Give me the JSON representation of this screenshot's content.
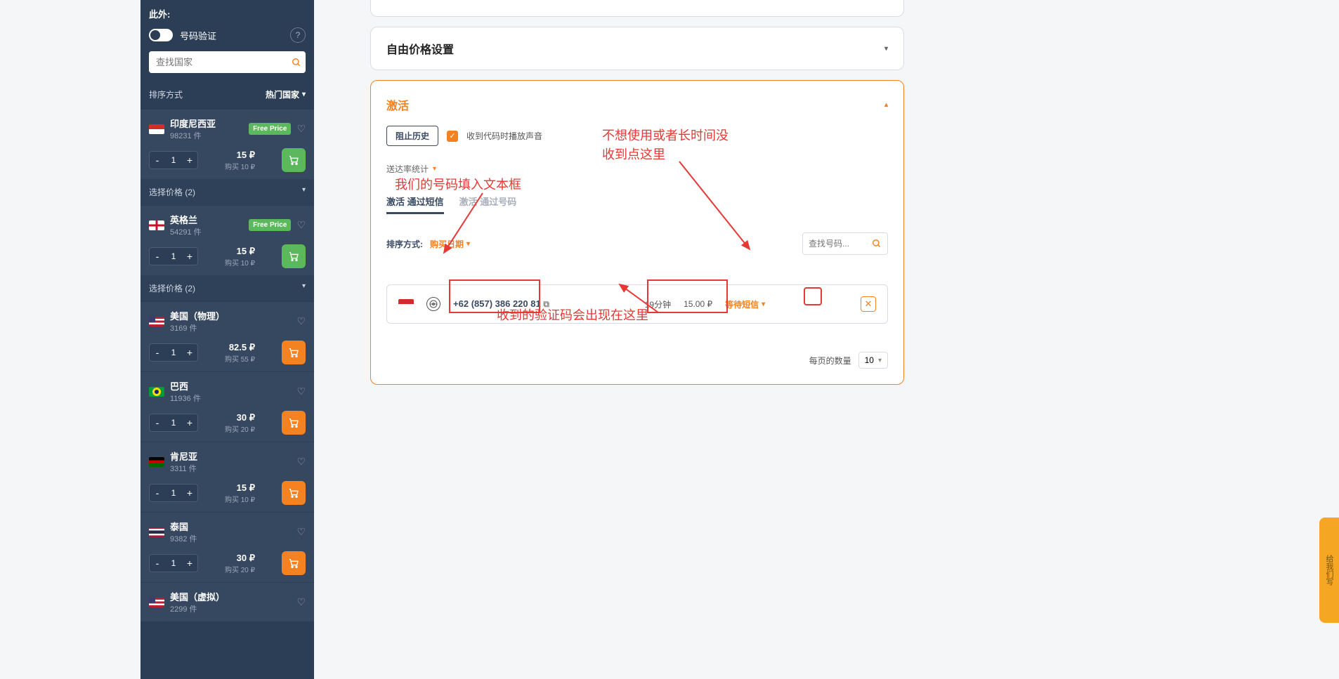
{
  "sidebar": {
    "also_label": "此外:",
    "toggle_label": "号码验证",
    "search_placeholder": "查找国家",
    "sort_label": "排序方式",
    "sort_value": "热门国家",
    "select_price_label": "选择价格 (2)",
    "qty": "1",
    "countries": [
      {
        "name": "印度尼西亚",
        "count": "98231 件",
        "price": "15 ₽",
        "buy_for": "购买 10 ₽",
        "free": "Free Price",
        "flag": "id",
        "cart": "green",
        "show_select": true
      },
      {
        "name": "英格兰",
        "count": "54291 件",
        "price": "15 ₽",
        "buy_for": "购买 10 ₽",
        "free": "Free Price",
        "flag": "en",
        "cart": "green",
        "show_select": true
      },
      {
        "name": "美国（物理）",
        "count": "3169 件",
        "price": "82.5 ₽",
        "buy_for": "购买 55 ₽",
        "flag": "us",
        "cart": "orange"
      },
      {
        "name": "巴西",
        "count": "11936 件",
        "price": "30 ₽",
        "buy_for": "购买 20 ₽",
        "flag": "br",
        "cart": "orange"
      },
      {
        "name": "肯尼亚",
        "count": "3311 件",
        "price": "15 ₽",
        "buy_for": "购买 10 ₽",
        "flag": "ke",
        "cart": "orange"
      },
      {
        "name": "泰国",
        "count": "9382 件",
        "price": "30 ₽",
        "buy_for": "购买 20 ₽",
        "flag": "th",
        "cart": "orange"
      },
      {
        "name": "美国（虚拟）",
        "count": "2299 件",
        "flag": "us"
      }
    ]
  },
  "panel1": {
    "empty": ""
  },
  "panel2": {
    "title": "自由价格设置"
  },
  "activation": {
    "title": "激活",
    "block_history": "阻止历史",
    "play_sound": "收到代码时播放声音",
    "stats": "送达率统计",
    "tab_sms": "激活 通过短信",
    "tab_num": "激活 通过号码",
    "sort_label": "排序方式:",
    "sort_value": "购买日期",
    "search_placeholder": "查找号码...",
    "row": {
      "prefix": "+62",
      "number": "(857) 386 220 81",
      "timer": "19分钟",
      "price": "15.00 ₽",
      "wait": "等待短信"
    },
    "per_page_label": "每页的数量",
    "per_page_value": "10"
  },
  "annotations": {
    "a1": "我们的号码填入文本框",
    "a2": "不想使用或者长时间没收到点这里",
    "a3": "收到的验证码会出现在这里"
  },
  "side_tab": "给我们写"
}
